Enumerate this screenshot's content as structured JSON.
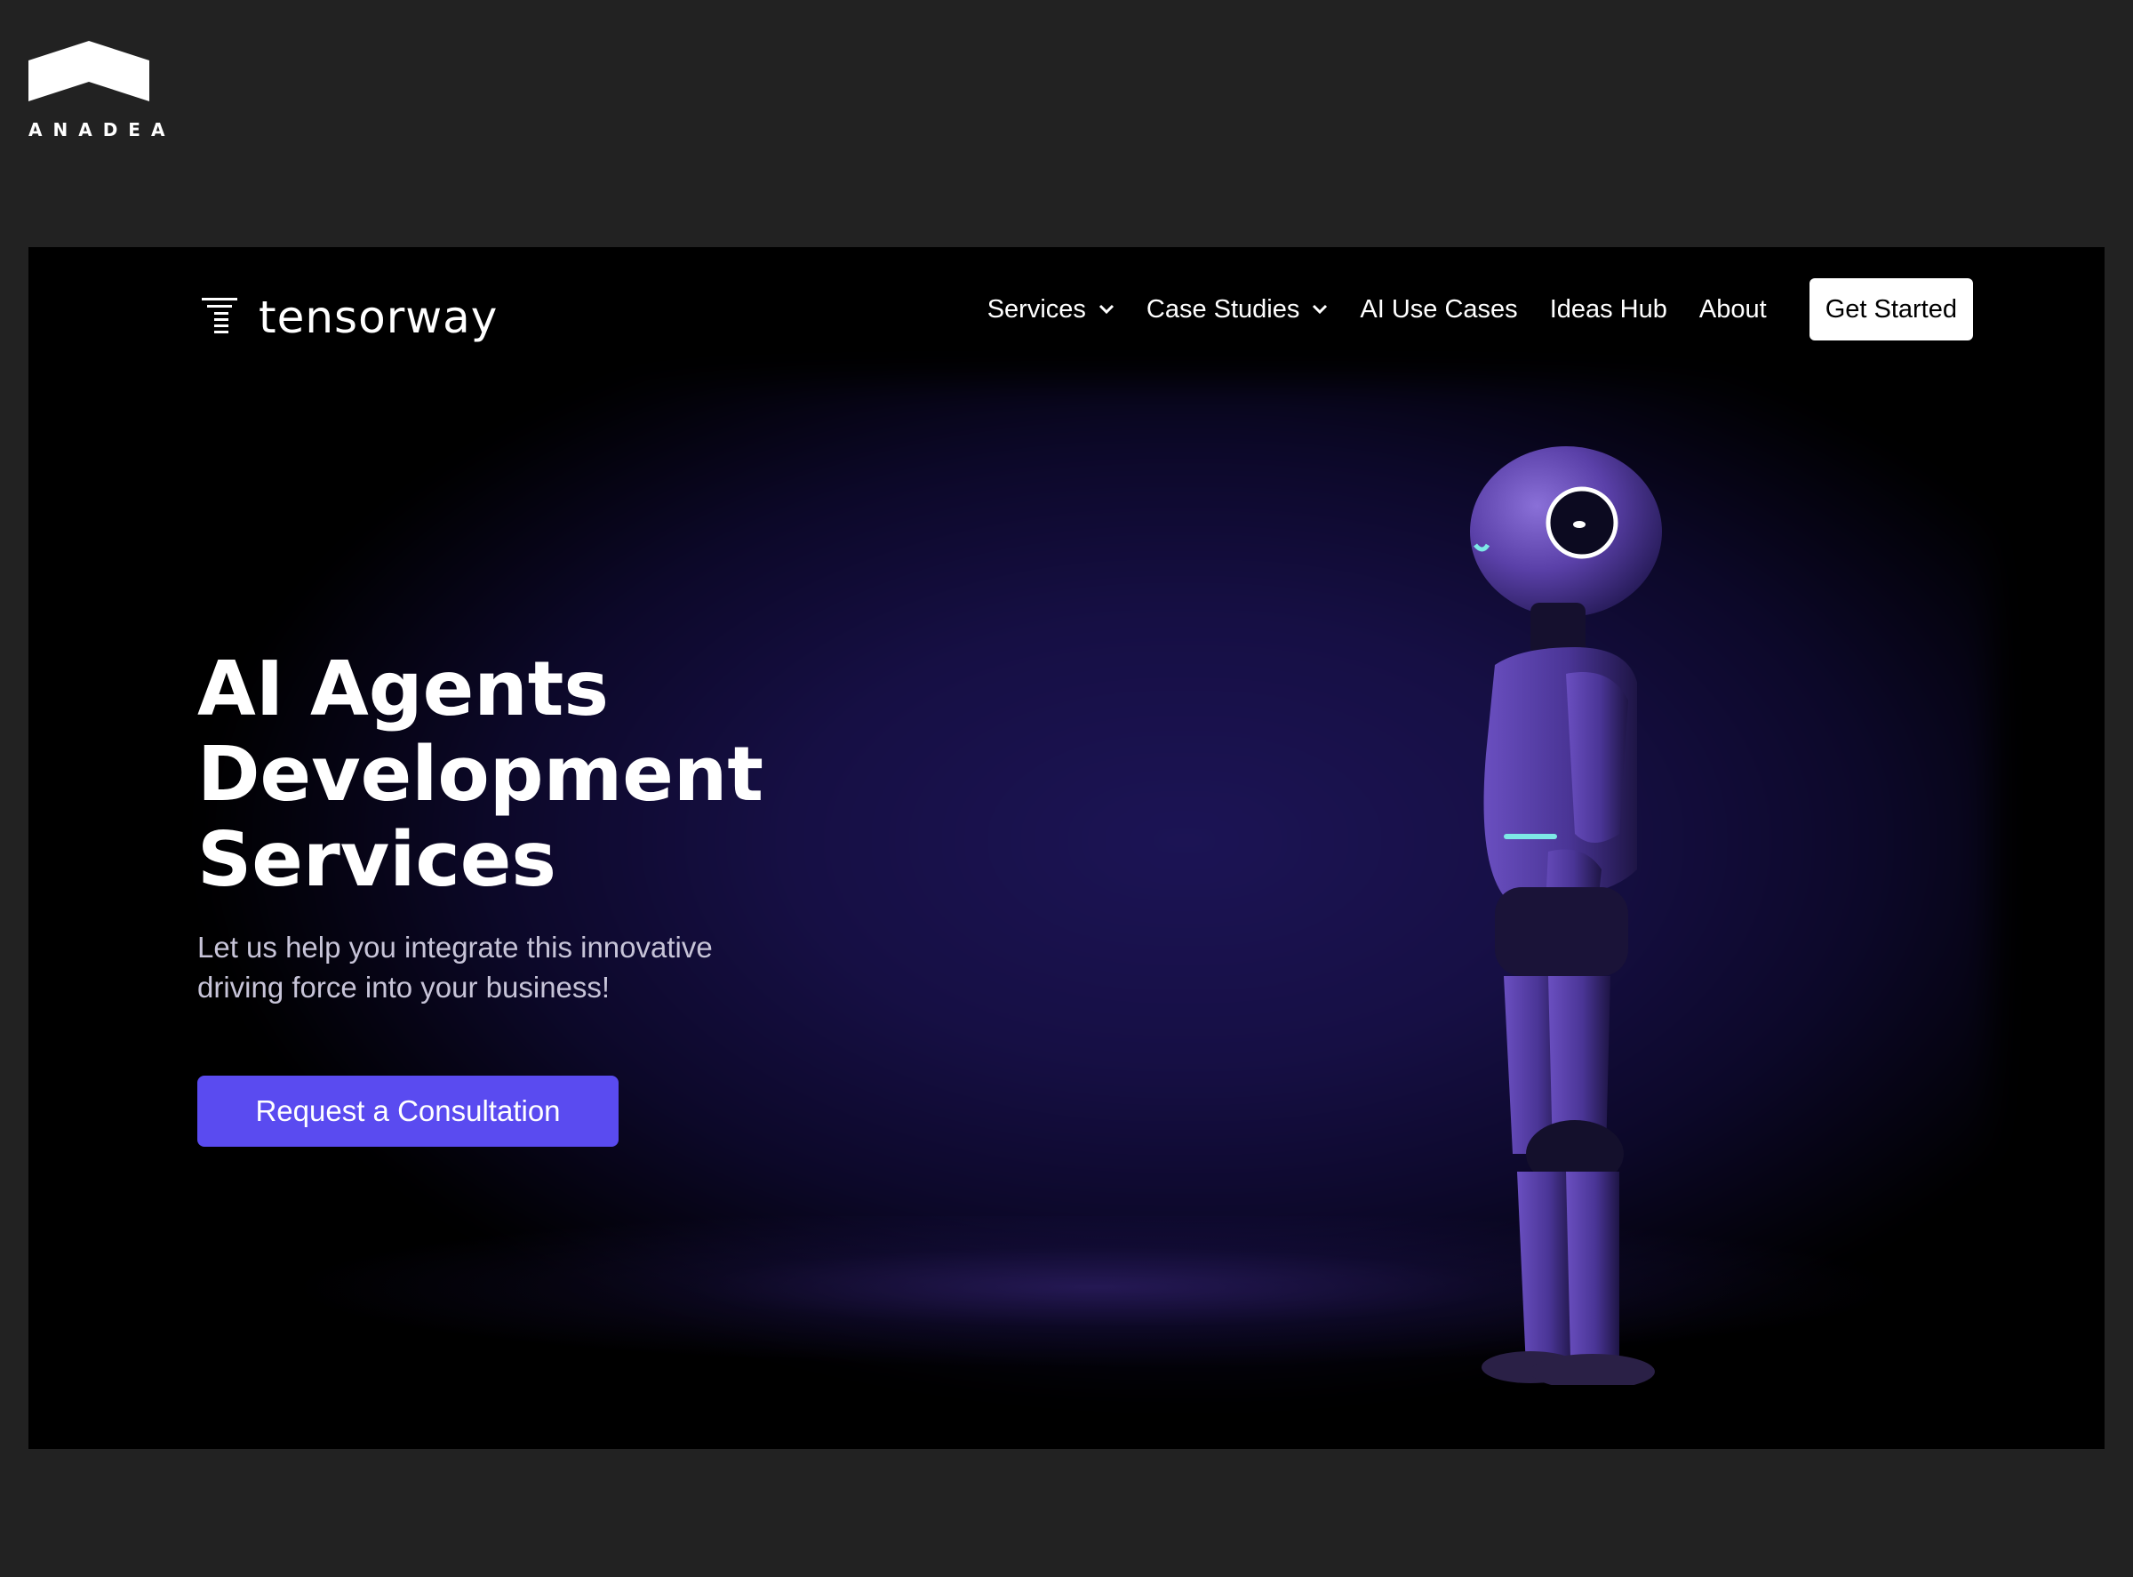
{
  "watermark": {
    "brand": "ANADEA",
    "icon": "house-roof-icon"
  },
  "site": {
    "logo_text": "tensorway",
    "logo_icon": "tensorway-stack-icon",
    "nav": [
      {
        "label": "Services",
        "has_dropdown": true
      },
      {
        "label": "Case Studies",
        "has_dropdown": true
      },
      {
        "label": "AI Use Cases",
        "has_dropdown": false
      },
      {
        "label": "Ideas Hub",
        "has_dropdown": false
      },
      {
        "label": "About",
        "has_dropdown": false
      }
    ],
    "cta_label": "Get Started"
  },
  "hero": {
    "title_lines": [
      "AI Agents",
      "Development",
      "Services"
    ],
    "subtitle": "Let us help you integrate this innovative driving force into your business!",
    "button_label": "Request a Consultation",
    "image": "robot-illustration"
  },
  "colors": {
    "page_background": "#222222",
    "hero_background": "#000000",
    "accent": "#5a4bf0",
    "glow": "#1c1455"
  }
}
